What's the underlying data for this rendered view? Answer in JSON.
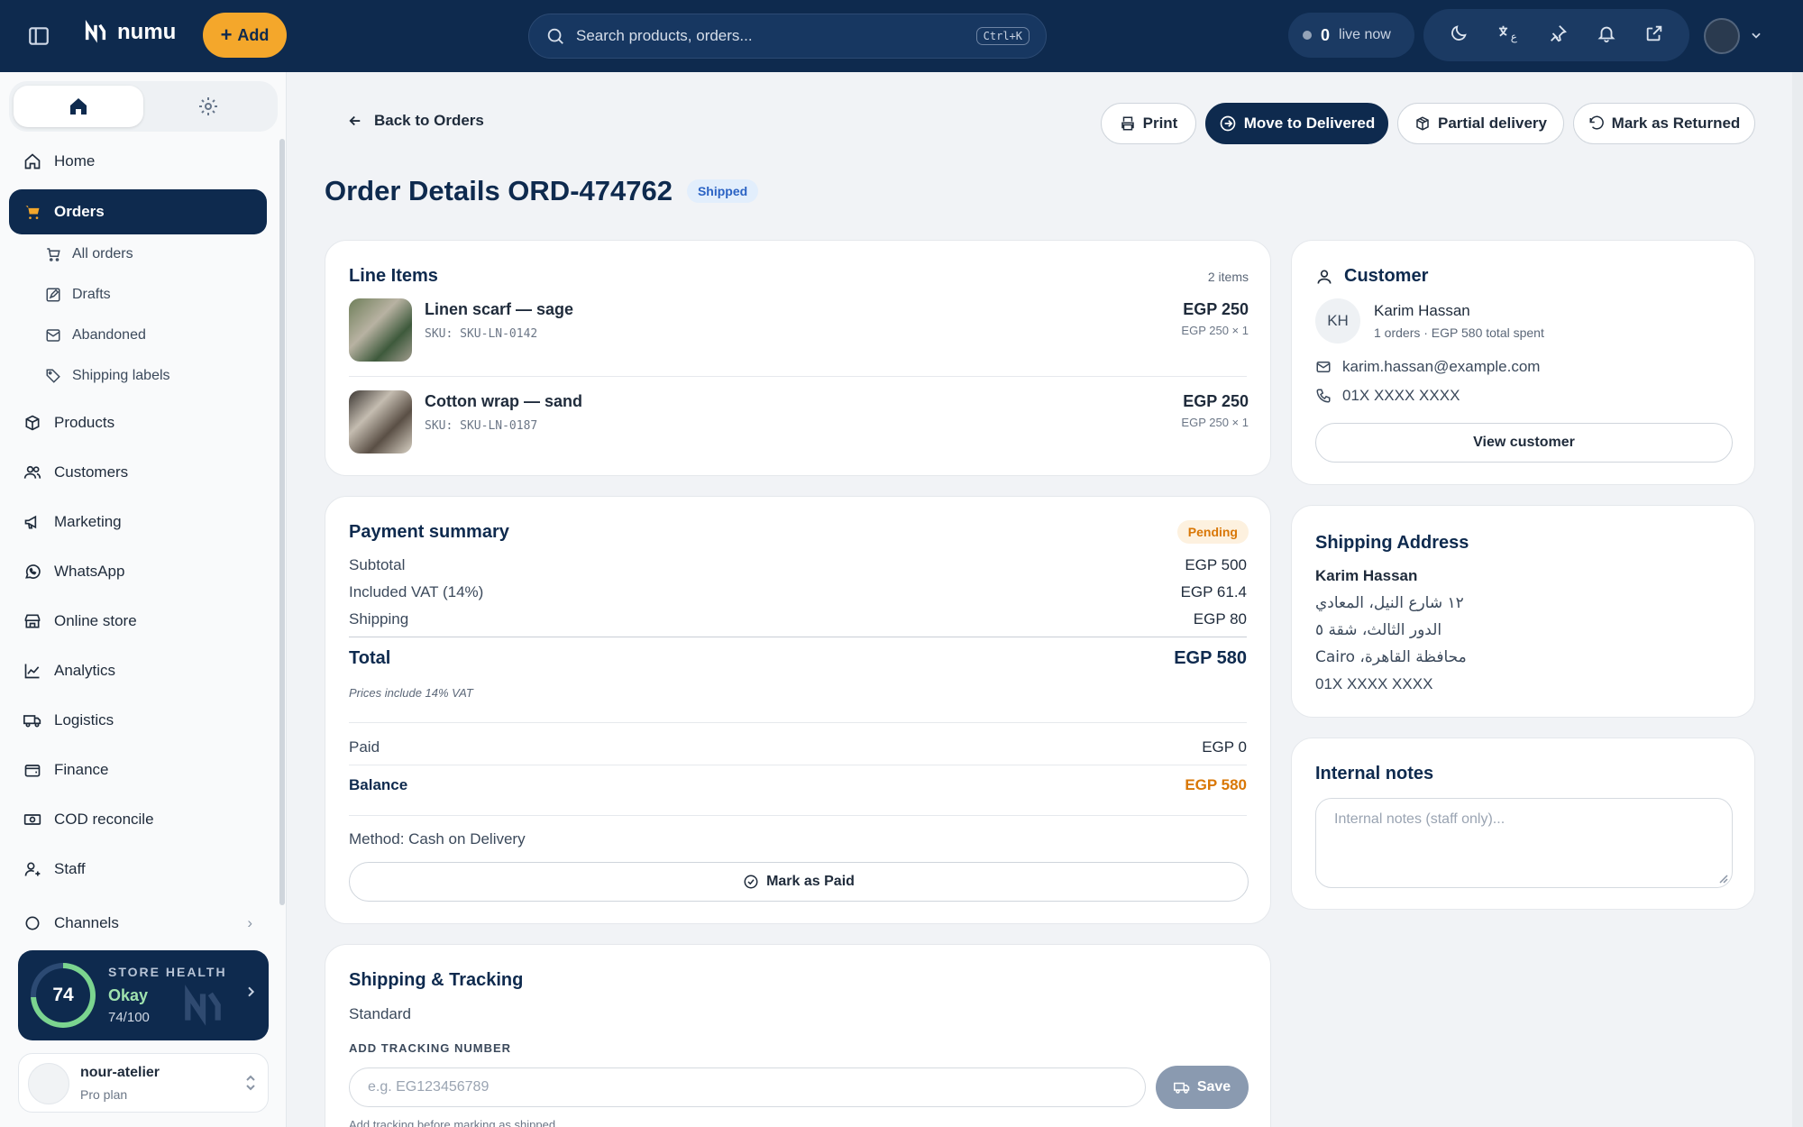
{
  "app": {
    "logo_text": "numu",
    "add_label": "Add"
  },
  "search": {
    "placeholder": "Search products, orders...",
    "shortcut": "Ctrl+K"
  },
  "live": {
    "count": "0",
    "label": "live now"
  },
  "sidebar": {
    "items": [
      {
        "label": "Home",
        "icon": "home-icon"
      },
      {
        "label": "Orders",
        "icon": "cart-icon"
      },
      {
        "label": "Products",
        "icon": "box-icon"
      },
      {
        "label": "Customers",
        "icon": "users-icon"
      },
      {
        "label": "Marketing",
        "icon": "megaphone-icon"
      },
      {
        "label": "WhatsApp",
        "icon": "whatsapp-icon"
      },
      {
        "label": "Online store",
        "icon": "store-icon"
      },
      {
        "label": "Analytics",
        "icon": "chart-icon"
      },
      {
        "label": "Logistics",
        "icon": "truck-icon"
      },
      {
        "label": "Finance",
        "icon": "wallet-icon"
      },
      {
        "label": "COD reconcile",
        "icon": "cash-icon"
      },
      {
        "label": "Staff",
        "icon": "staff-icon"
      },
      {
        "label": "Channels",
        "icon": "channels-icon"
      }
    ],
    "order_sub": [
      {
        "label": "All orders"
      },
      {
        "label": "Drafts"
      },
      {
        "label": "Abandoned"
      },
      {
        "label": "Shipping labels"
      }
    ],
    "health": {
      "score": "74",
      "title": "STORE HEALTH",
      "status": "Okay",
      "score_text": "74/100",
      "fraction": 0.74
    },
    "store": {
      "name": "nour-atelier",
      "plan": "Pro plan"
    }
  },
  "actions": {
    "back": "Back to Orders",
    "print": "Print",
    "move": "Move to Delivered",
    "partial": "Partial delivery",
    "returned": "Mark as Returned"
  },
  "order": {
    "title": "Order Details ORD-474762",
    "status": "Shipped"
  },
  "line_items": {
    "title": "Line Items",
    "count": "2 items",
    "items": [
      {
        "name": "Linen scarf — sage",
        "sku": "SKU: SKU-LN-0142",
        "price": "EGP 250",
        "qty": "EGP 250 × 1"
      },
      {
        "name": "Cotton wrap — sand",
        "sku": "SKU: SKU-LN-0187",
        "price": "EGP 250",
        "qty": "EGP 250 × 1"
      }
    ]
  },
  "payment": {
    "title": "Payment summary",
    "status": "Pending",
    "subtotal_label": "Subtotal",
    "subtotal": "EGP 500",
    "vat_label": "Included VAT (14%)",
    "vat": "EGP 61.4",
    "shipping_label": "Shipping",
    "shipping": "EGP 80",
    "total_label": "Total",
    "total": "EGP 580",
    "vat_note": "Prices include 14% VAT",
    "paid_label": "Paid",
    "paid": "EGP 0",
    "balance_label": "Balance",
    "balance": "EGP 580",
    "method": "Method: Cash on Delivery",
    "mark_paid": "Mark as Paid"
  },
  "shipping": {
    "title": "Shipping & Tracking",
    "method": "Standard",
    "tracking_label": "ADD TRACKING NUMBER",
    "placeholder": "e.g. EG123456789",
    "save": "Save",
    "hint": "Add tracking before marking as shipped"
  },
  "customer": {
    "title": "Customer",
    "initials": "KH",
    "name": "Karim Hassan",
    "summary": "1 orders · EGP 580 total spent",
    "email": "karim.hassan@example.com",
    "phone": "01X XXXX XXXX",
    "view": "View customer"
  },
  "address": {
    "title": "Shipping Address",
    "name": "Karim Hassan",
    "line1": "١٢ شارع النيل، المعادي",
    "line2": "الدور الثالث، شقة ٥",
    "line3": "محافظة القاهرة، Cairo",
    "phone": "01X XXXX XXXX"
  },
  "notes": {
    "title": "Internal notes",
    "placeholder": "Internal notes (staff only)..."
  },
  "colors": {
    "brand": "#0e2a4e",
    "accent": "#f4a72b",
    "pending": "#d97706"
  }
}
